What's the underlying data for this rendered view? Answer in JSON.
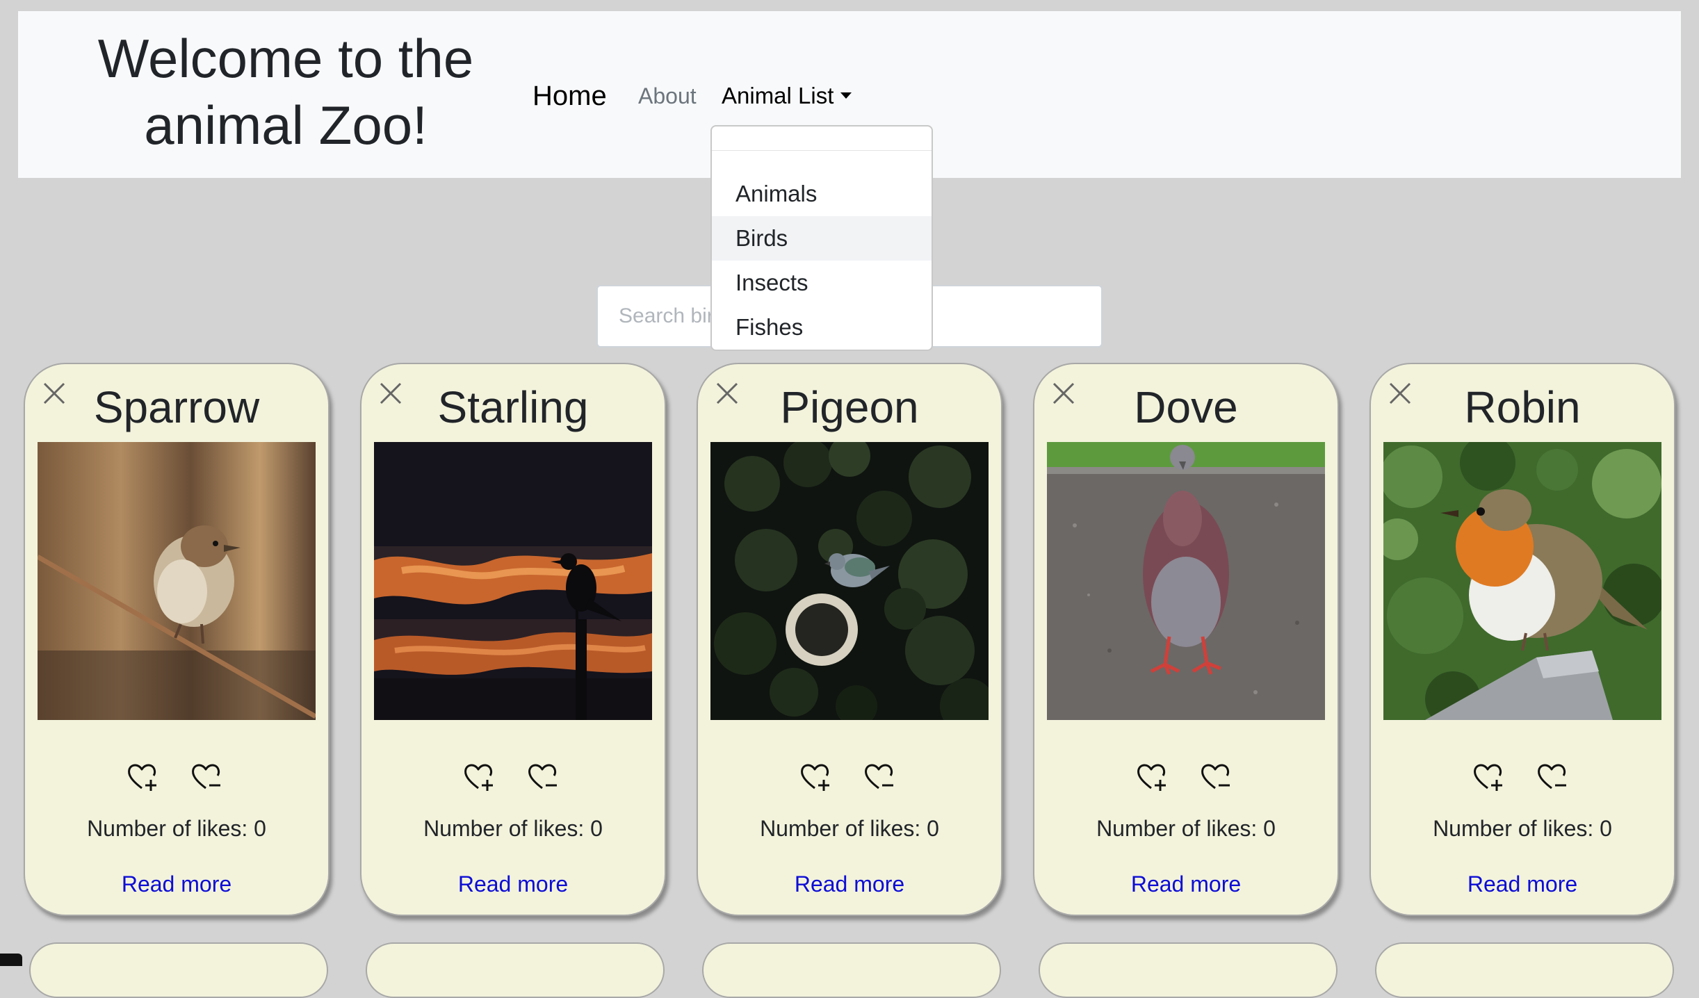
{
  "navbar": {
    "brand": "Welcome to the animal Zoo!",
    "home": "Home",
    "about": "About",
    "animal_list": "Animal List"
  },
  "dropdown": {
    "items": [
      "Animals",
      "Birds",
      "Insects",
      "Fishes"
    ],
    "highlighted": "Birds"
  },
  "search": {
    "placeholder": "Search birds",
    "value": ""
  },
  "cards": [
    {
      "name": "Sparrow",
      "likes_label": "Number of likes: 0",
      "likes": 0,
      "read_more": "Read more"
    },
    {
      "name": "Starling",
      "likes_label": "Number of likes: 0",
      "likes": 0,
      "read_more": "Read more"
    },
    {
      "name": "Pigeon",
      "likes_label": "Number of likes: 0",
      "likes": 0,
      "read_more": "Read more"
    },
    {
      "name": "Dove",
      "likes_label": "Number of likes: 0",
      "likes": 0,
      "read_more": "Read more"
    },
    {
      "name": "Robin",
      "likes_label": "Number of likes: 0",
      "likes": 0,
      "read_more": "Read more"
    }
  ],
  "icons": {
    "close": "close-icon",
    "like": "heart-plus-icon",
    "unlike": "heart-minus-icon"
  },
  "colors": {
    "page_background": "#d3d3d3",
    "navbar_background": "#f8f9fa",
    "card_background": "#f3f3dc",
    "link": "#0d0dd6"
  }
}
